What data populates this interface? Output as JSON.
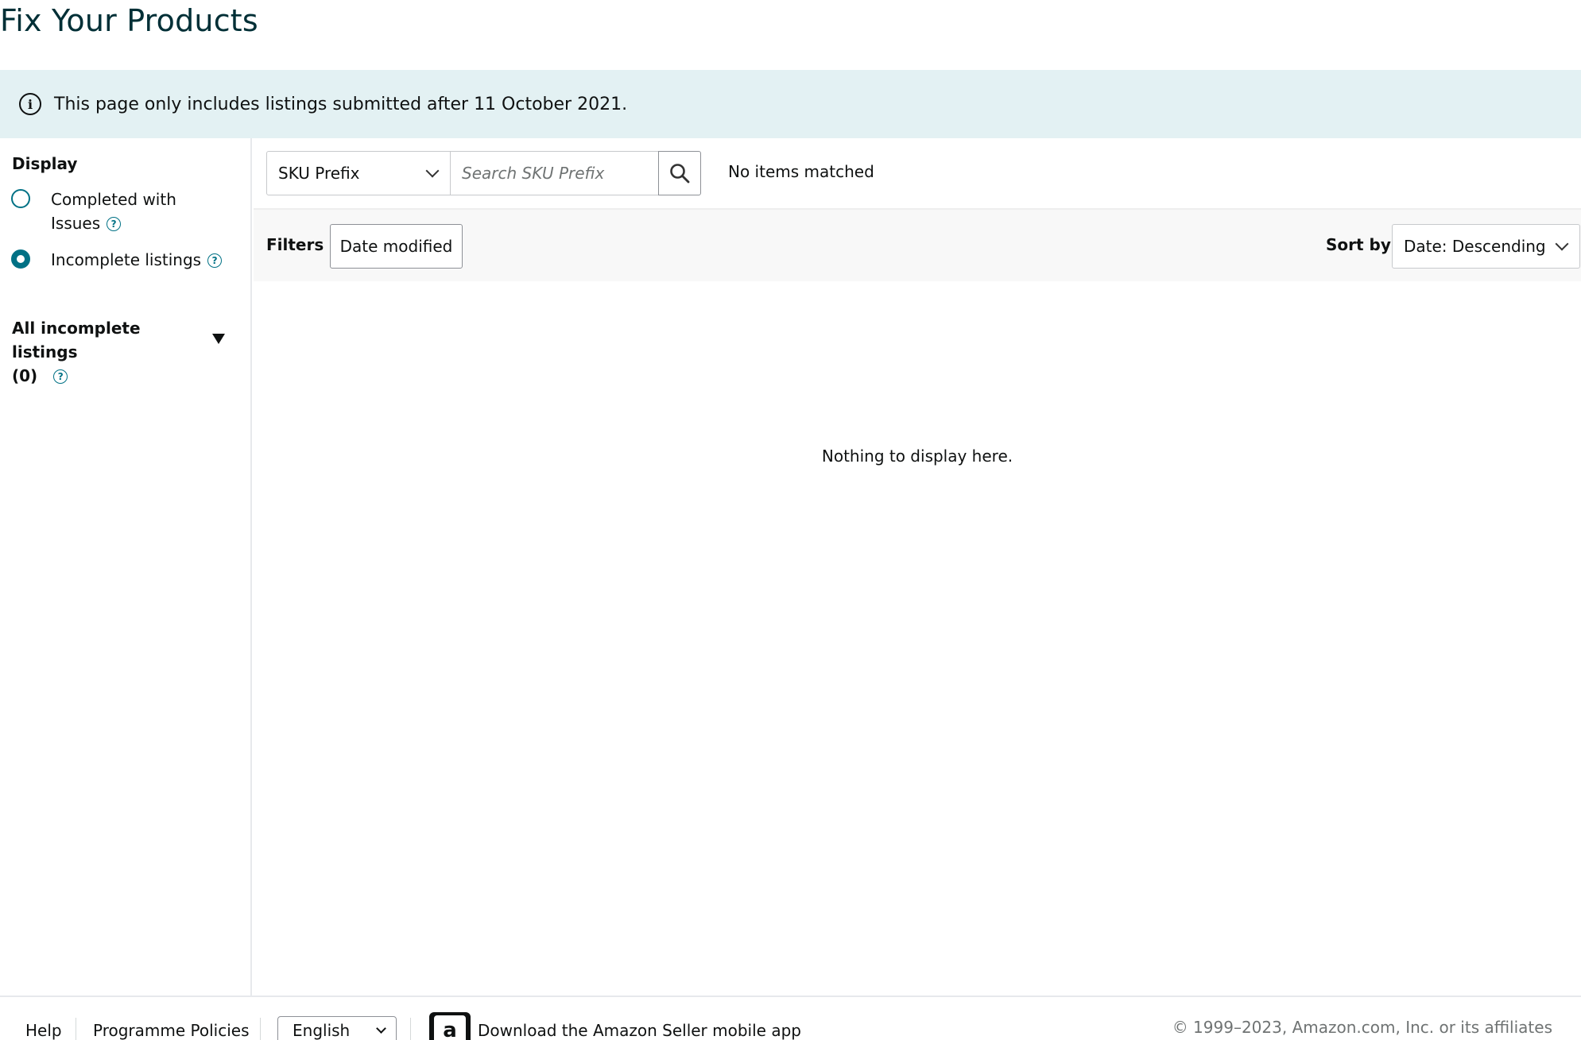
{
  "page": {
    "title": "Fix Your Products"
  },
  "banner": {
    "text": "This page only includes listings submitted after 11 October 2021."
  },
  "sidebar": {
    "display_label": "Display",
    "options": [
      {
        "label_line1": "Completed with",
        "label_line2": "Issues",
        "checked": false
      },
      {
        "label": "Incomplete listings",
        "checked": true
      }
    ],
    "category": {
      "label_line1": "All incomplete listings",
      "label_line2": "(0)"
    },
    "help_glyph": "?"
  },
  "toolbar": {
    "search_by": "SKU Prefix",
    "search_placeholder": "Search SKU Prefix",
    "result_text": "No items matched"
  },
  "filterbar": {
    "filters_label": "Filters",
    "date_button": "Date modified",
    "sort_label": "Sort by",
    "sort_value": "Date: Descending"
  },
  "main": {
    "empty_message": "Nothing to display here."
  },
  "footer": {
    "help": "Help",
    "policies": "Programme Policies",
    "language": "English",
    "app_link": "Download the Amazon Seller mobile app",
    "app_logo_letter": "a",
    "copyright": "© 1999–2023, Amazon.com, Inc. or its affiliates"
  },
  "colors": {
    "accent": "#007185",
    "banner_bg": "#e3f1f3",
    "title": "#002f36"
  }
}
